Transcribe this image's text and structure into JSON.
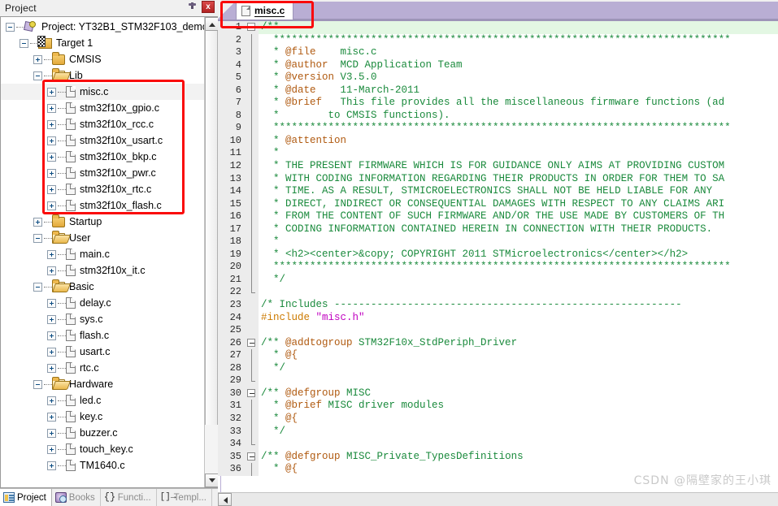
{
  "panel": {
    "title": "Project",
    "pin_icon": "pin-icon",
    "close_label": "x"
  },
  "tree": [
    {
      "label": "Project: YT32B1_STM32F103_demo",
      "depth": 0,
      "icon": "project-icon",
      "expander": "minus"
    },
    {
      "label": "Target 1",
      "depth": 1,
      "icon": "target-icon",
      "expander": "minus"
    },
    {
      "label": "CMSIS",
      "depth": 2,
      "icon": "folder-icon",
      "expander": "plus"
    },
    {
      "label": "Lib",
      "depth": 2,
      "icon": "folder-open-icon",
      "expander": "minus"
    },
    {
      "label": "misc.c",
      "depth": 3,
      "icon": "file-icon",
      "expander": "plus",
      "selected": true
    },
    {
      "label": "stm32f10x_gpio.c",
      "depth": 3,
      "icon": "file-icon",
      "expander": "plus"
    },
    {
      "label": "stm32f10x_rcc.c",
      "depth": 3,
      "icon": "file-icon",
      "expander": "plus"
    },
    {
      "label": "stm32f10x_usart.c",
      "depth": 3,
      "icon": "file-icon",
      "expander": "plus"
    },
    {
      "label": "stm32f10x_bkp.c",
      "depth": 3,
      "icon": "file-icon",
      "expander": "plus"
    },
    {
      "label": "stm32f10x_pwr.c",
      "depth": 3,
      "icon": "file-icon",
      "expander": "plus"
    },
    {
      "label": "stm32f10x_rtc.c",
      "depth": 3,
      "icon": "file-icon",
      "expander": "plus"
    },
    {
      "label": "stm32f10x_flash.c",
      "depth": 3,
      "icon": "file-icon",
      "expander": "plus"
    },
    {
      "label": "Startup",
      "depth": 2,
      "icon": "folder-icon",
      "expander": "plus"
    },
    {
      "label": "User",
      "depth": 2,
      "icon": "folder-open-icon",
      "expander": "minus"
    },
    {
      "label": "main.c",
      "depth": 3,
      "icon": "file-icon",
      "expander": "plus"
    },
    {
      "label": "stm32f10x_it.c",
      "depth": 3,
      "icon": "file-icon",
      "expander": "plus"
    },
    {
      "label": "Basic",
      "depth": 2,
      "icon": "folder-open-icon",
      "expander": "minus"
    },
    {
      "label": "delay.c",
      "depth": 3,
      "icon": "file-icon",
      "expander": "plus"
    },
    {
      "label": "sys.c",
      "depth": 3,
      "icon": "file-icon",
      "expander": "plus"
    },
    {
      "label": "flash.c",
      "depth": 3,
      "icon": "file-icon",
      "expander": "plus"
    },
    {
      "label": "usart.c",
      "depth": 3,
      "icon": "file-icon",
      "expander": "plus"
    },
    {
      "label": "rtc.c",
      "depth": 3,
      "icon": "file-icon",
      "expander": "plus"
    },
    {
      "label": "Hardware",
      "depth": 2,
      "icon": "folder-open-icon",
      "expander": "minus"
    },
    {
      "label": "led.c",
      "depth": 3,
      "icon": "file-icon",
      "expander": "plus"
    },
    {
      "label": "key.c",
      "depth": 3,
      "icon": "file-icon",
      "expander": "plus"
    },
    {
      "label": "buzzer.c",
      "depth": 3,
      "icon": "file-icon",
      "expander": "plus"
    },
    {
      "label": "touch_key.c",
      "depth": 3,
      "icon": "file-icon",
      "expander": "plus"
    },
    {
      "label": "TM1640.c",
      "depth": 3,
      "icon": "file-icon",
      "expander": "plus"
    }
  ],
  "bottom_tabs": [
    {
      "label": "Project",
      "icon": "project-tab-icon",
      "active": true,
      "glyph": ""
    },
    {
      "label": "Books",
      "icon": "books-tab-icon",
      "active": false,
      "glyph": ""
    },
    {
      "label": "Functi...",
      "icon": "functions-tab-icon",
      "active": false,
      "glyph": "{}"
    },
    {
      "label": "Templ...",
      "icon": "templates-tab-icon",
      "active": false,
      "glyph": "[]→"
    }
  ],
  "editor": {
    "tab_label": "misc.c",
    "tab_icon": "file-icon"
  },
  "code": [
    {
      "n": 1,
      "fold": "minus",
      "cur": true,
      "segs": [
        {
          "t": "/**",
          "c": "c-cmt"
        }
      ]
    },
    {
      "n": 2,
      "fold": "line",
      "segs": [
        {
          "t": "  ***************************************************************************",
          "c": "c-cmt"
        }
      ]
    },
    {
      "n": 3,
      "fold": "line",
      "segs": [
        {
          "t": "  * ",
          "c": "c-cmt"
        },
        {
          "t": "@file",
          "c": "c-doc"
        },
        {
          "t": "    misc.c",
          "c": "c-cmt"
        }
      ]
    },
    {
      "n": 4,
      "fold": "line",
      "segs": [
        {
          "t": "  * ",
          "c": "c-cmt"
        },
        {
          "t": "@author",
          "c": "c-doc"
        },
        {
          "t": "  MCD Application Team",
          "c": "c-cmt"
        }
      ]
    },
    {
      "n": 5,
      "fold": "line",
      "segs": [
        {
          "t": "  * ",
          "c": "c-cmt"
        },
        {
          "t": "@version",
          "c": "c-doc"
        },
        {
          "t": " V3.5.0",
          "c": "c-cmt"
        }
      ]
    },
    {
      "n": 6,
      "fold": "line",
      "segs": [
        {
          "t": "  * ",
          "c": "c-cmt"
        },
        {
          "t": "@date",
          "c": "c-doc"
        },
        {
          "t": "    11-March-2011",
          "c": "c-cmt"
        }
      ]
    },
    {
      "n": 7,
      "fold": "line",
      "segs": [
        {
          "t": "  * ",
          "c": "c-cmt"
        },
        {
          "t": "@brief",
          "c": "c-doc"
        },
        {
          "t": "   This file provides all the miscellaneous firmware functions (ad",
          "c": "c-cmt"
        }
      ]
    },
    {
      "n": 8,
      "fold": "line",
      "segs": [
        {
          "t": "  *        to CMSIS functions).",
          "c": "c-cmt"
        }
      ]
    },
    {
      "n": 9,
      "fold": "line",
      "segs": [
        {
          "t": "  ***************************************************************************",
          "c": "c-cmt"
        }
      ]
    },
    {
      "n": 10,
      "fold": "line",
      "segs": [
        {
          "t": "  * ",
          "c": "c-cmt"
        },
        {
          "t": "@attention",
          "c": "c-doc"
        }
      ]
    },
    {
      "n": 11,
      "fold": "line",
      "segs": [
        {
          "t": "  *",
          "c": "c-cmt"
        }
      ]
    },
    {
      "n": 12,
      "fold": "line",
      "segs": [
        {
          "t": "  * THE PRESENT FIRMWARE WHICH IS FOR GUIDANCE ONLY AIMS AT PROVIDING CUSTOM",
          "c": "c-cmt"
        }
      ]
    },
    {
      "n": 13,
      "fold": "line",
      "segs": [
        {
          "t": "  * WITH CODING INFORMATION REGARDING THEIR PRODUCTS IN ORDER FOR THEM TO SA",
          "c": "c-cmt"
        }
      ]
    },
    {
      "n": 14,
      "fold": "line",
      "segs": [
        {
          "t": "  * TIME. AS A RESULT, STMICROELECTRONICS SHALL NOT BE HELD LIABLE FOR ANY",
          "c": "c-cmt"
        }
      ]
    },
    {
      "n": 15,
      "fold": "line",
      "segs": [
        {
          "t": "  * DIRECT, INDIRECT OR CONSEQUENTIAL DAMAGES WITH RESPECT TO ANY CLAIMS ARI",
          "c": "c-cmt"
        }
      ]
    },
    {
      "n": 16,
      "fold": "line",
      "segs": [
        {
          "t": "  * FROM THE CONTENT OF SUCH FIRMWARE AND/OR THE USE MADE BY CUSTOMERS OF TH",
          "c": "c-cmt"
        }
      ]
    },
    {
      "n": 17,
      "fold": "line",
      "segs": [
        {
          "t": "  * CODING INFORMATION CONTAINED HEREIN IN CONNECTION WITH THEIR PRODUCTS.",
          "c": "c-cmt"
        }
      ]
    },
    {
      "n": 18,
      "fold": "line",
      "segs": [
        {
          "t": "  *",
          "c": "c-cmt"
        }
      ]
    },
    {
      "n": 19,
      "fold": "line",
      "segs": [
        {
          "t": "  * <h2><center>&copy; COPYRIGHT 2011 STMicroelectronics</center></h2>",
          "c": "c-cmt"
        }
      ]
    },
    {
      "n": 20,
      "fold": "line",
      "segs": [
        {
          "t": "  ***************************************************************************",
          "c": "c-cmt"
        }
      ]
    },
    {
      "n": 21,
      "fold": "line",
      "segs": [
        {
          "t": "  */",
          "c": "c-cmt"
        }
      ]
    },
    {
      "n": 22,
      "fold": "elbow",
      "segs": [
        {
          "t": "",
          "c": "c-plain"
        }
      ]
    },
    {
      "n": 23,
      "fold": "",
      "segs": [
        {
          "t": "/* Includes ---------------------------------------------------------",
          "c": "c-cmt"
        }
      ]
    },
    {
      "n": 24,
      "fold": "",
      "segs": [
        {
          "t": "#include ",
          "c": "c-pre"
        },
        {
          "t": "\"misc.h\"",
          "c": "c-str"
        }
      ]
    },
    {
      "n": 25,
      "fold": "",
      "segs": [
        {
          "t": "",
          "c": "c-plain"
        }
      ]
    },
    {
      "n": 26,
      "fold": "minus",
      "segs": [
        {
          "t": "/** ",
          "c": "c-cmt"
        },
        {
          "t": "@addtogroup",
          "c": "c-doc"
        },
        {
          "t": " STM32F10x_StdPeriph_Driver",
          "c": "c-cmt"
        }
      ]
    },
    {
      "n": 27,
      "fold": "line",
      "segs": [
        {
          "t": "  * ",
          "c": "c-cmt"
        },
        {
          "t": "@{",
          "c": "c-doc"
        }
      ]
    },
    {
      "n": 28,
      "fold": "line",
      "segs": [
        {
          "t": "  */",
          "c": "c-cmt"
        }
      ]
    },
    {
      "n": 29,
      "fold": "elbow",
      "segs": [
        {
          "t": "",
          "c": "c-plain"
        }
      ]
    },
    {
      "n": 30,
      "fold": "minus",
      "segs": [
        {
          "t": "/** ",
          "c": "c-cmt"
        },
        {
          "t": "@defgroup",
          "c": "c-doc"
        },
        {
          "t": " MISC",
          "c": "c-cmt"
        }
      ]
    },
    {
      "n": 31,
      "fold": "line",
      "segs": [
        {
          "t": "  * ",
          "c": "c-cmt"
        },
        {
          "t": "@brief",
          "c": "c-doc"
        },
        {
          "t": " MISC driver modules",
          "c": "c-cmt"
        }
      ]
    },
    {
      "n": 32,
      "fold": "line",
      "segs": [
        {
          "t": "  * ",
          "c": "c-cmt"
        },
        {
          "t": "@{",
          "c": "c-doc"
        }
      ]
    },
    {
      "n": 33,
      "fold": "line",
      "segs": [
        {
          "t": "  */",
          "c": "c-cmt"
        }
      ]
    },
    {
      "n": 34,
      "fold": "elbow",
      "segs": [
        {
          "t": "",
          "c": "c-plain"
        }
      ]
    },
    {
      "n": 35,
      "fold": "minus",
      "segs": [
        {
          "t": "/** ",
          "c": "c-cmt"
        },
        {
          "t": "@defgroup",
          "c": "c-doc"
        },
        {
          "t": " MISC_Private_TypesDefinitions",
          "c": "c-cmt"
        }
      ]
    },
    {
      "n": 36,
      "fold": "line",
      "segs": [
        {
          "t": "  * ",
          "c": "c-cmt"
        },
        {
          "t": "@{",
          "c": "c-doc"
        }
      ]
    }
  ],
  "watermark": "CSDN @隔壁家的王小琪",
  "colors": {
    "annotation": "#fa0a0a",
    "comment": "#1a8a3c",
    "doc_tag": "#b05a10",
    "preprocessor": "#cc7a00",
    "string": "#c000c0",
    "tab_strip": "#b9aed4",
    "current_line": "#e3f7e3"
  }
}
